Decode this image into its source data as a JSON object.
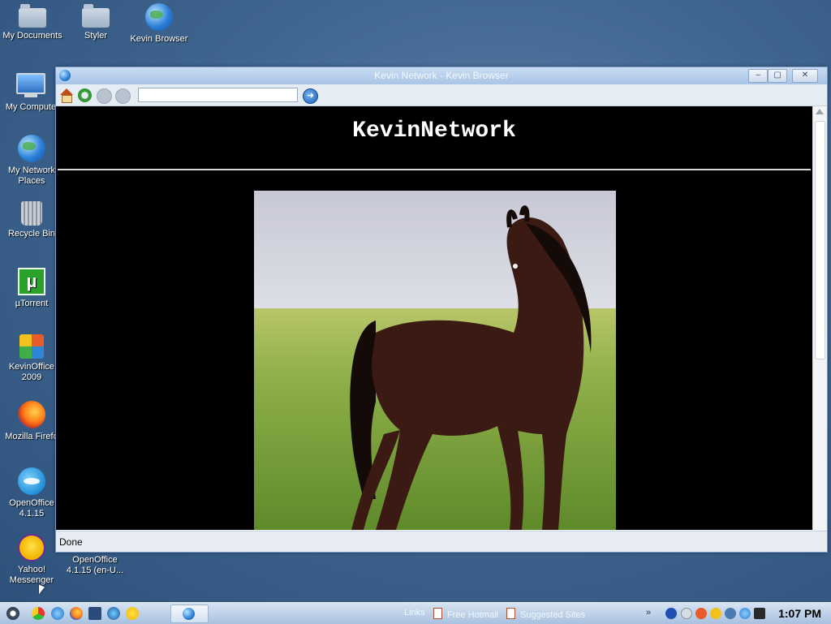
{
  "desktop": {
    "icons": [
      {
        "label": "My Documents",
        "icon": "folder-icon"
      },
      {
        "label": "Styler",
        "icon": "folder-icon"
      },
      {
        "label": "Kevin Browser",
        "icon": "globe-icon"
      },
      {
        "label": "My Compute",
        "icon": "monitor-icon"
      },
      {
        "label": "My Network",
        "label2": "Places",
        "icon": "network-globe-icon"
      },
      {
        "label": "Recycle Bin",
        "icon": "recycle-bin-icon"
      },
      {
        "label": "µTorrent",
        "icon": "utorrent-icon",
        "glyph": "µ"
      },
      {
        "label": "KevinOffice",
        "label2": "2009",
        "icon": "office-icon"
      },
      {
        "label": "Mozilla Firefo",
        "icon": "firefox-icon"
      },
      {
        "label": "OpenOffice",
        "label2": "4.1.15",
        "icon": "openoffice-icon"
      },
      {
        "label": "Yahoo!",
        "label2": "Messenger",
        "icon": "yahoo-messenger-icon"
      },
      {
        "label": "OpenOffice",
        "label2": "4.1.15 (en-U...",
        "icon": "openoffice-installer-icon"
      }
    ]
  },
  "browser": {
    "title": "Kevin Network - Kevin Browser",
    "address_value": "",
    "go_glyph": "➜",
    "page": {
      "heading": "KevinNetwork",
      "image_subject": "brown horse standing in a green grass field"
    },
    "status": "Done",
    "controls": {
      "minimize": "–",
      "maximize": "▢",
      "close": "✕"
    }
  },
  "taskbar": {
    "links_label": "Links",
    "links": [
      "Free Hotmail",
      "Suggested Sites"
    ],
    "chevron": "»",
    "clock": "1:07 PM"
  },
  "colors": {
    "desktop": "#3f6690",
    "titlebar": "#a8c4e6",
    "page_bg": "#000000",
    "heading": "#ffffff"
  }
}
